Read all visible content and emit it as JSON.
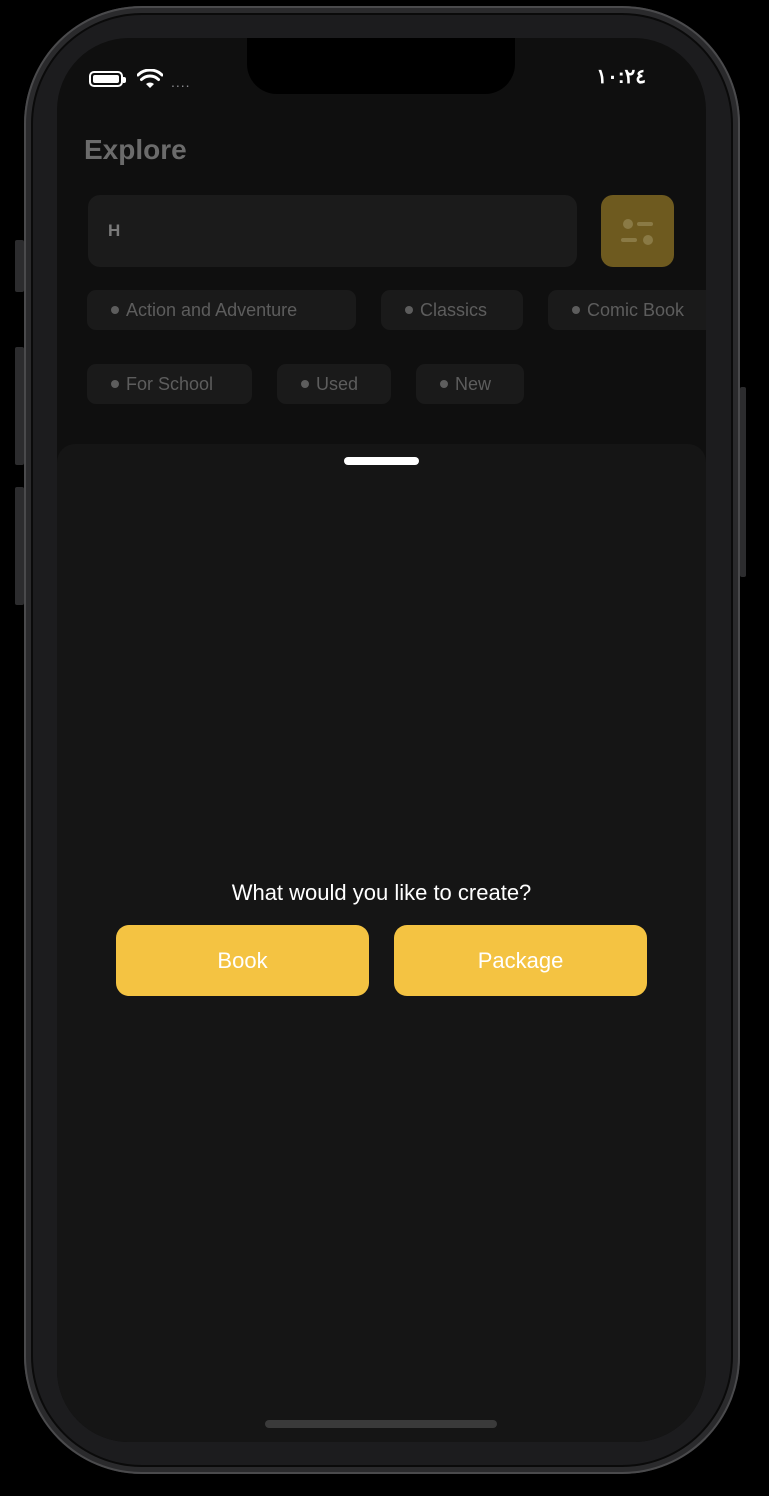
{
  "status_bar": {
    "time": "١٠:٢٤",
    "signal": "...."
  },
  "header": {
    "title": "Explore"
  },
  "search": {
    "value": "H"
  },
  "filters": {
    "row1": [
      "Action and Adventure",
      "Classics",
      "Comic Book"
    ],
    "row2": [
      "For School",
      "Used",
      "New"
    ]
  },
  "sheet": {
    "prompt": "What would you like to create?",
    "book_label": "Book",
    "package_label": "Package"
  },
  "colors": {
    "accent": "#f4c342",
    "sheet_bg": "#151515",
    "screen_bg": "#0f0f0f"
  }
}
